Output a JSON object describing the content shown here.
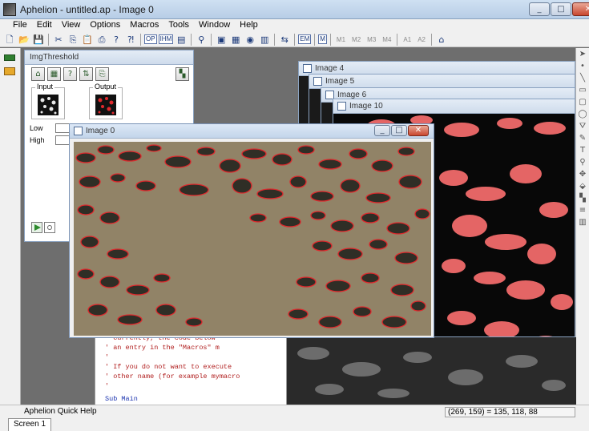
{
  "window": {
    "title": "Aphelion - untitled.ap - Image 0",
    "controls": [
      "_",
      "□",
      "✕"
    ]
  },
  "menu": [
    "File",
    "Edit",
    "View",
    "Options",
    "Macros",
    "Tools",
    "Window",
    "Help"
  ],
  "toolbar": {
    "labels": [
      "M1",
      "M2",
      "M3",
      "M4",
      "A1",
      "A2"
    ],
    "text_buttons": [
      "OP",
      "IHM",
      "EM",
      "M"
    ]
  },
  "threshold_panel": {
    "title": "ImgThreshold",
    "input_label": "Input",
    "output_label": "Output",
    "low_label": "Low",
    "high_label": "High"
  },
  "image_windows": [
    {
      "title": "Image 4"
    },
    {
      "title": "Image 5"
    },
    {
      "title": "Image 6"
    },
    {
      "title": "Image 10"
    }
  ],
  "main_image": {
    "title": "Image 0"
  },
  "code_editor": {
    "lines": [
      {
        "text": "' Currently, the code below",
        "kw": false
      },
      {
        "text": "' an entry in the \"Macros\" m",
        "kw": false
      },
      {
        "text": "'",
        "kw": false
      },
      {
        "text": "' If you do not want to execute",
        "kw": false
      },
      {
        "text": "' other name (for example mymacro",
        "kw": false
      },
      {
        "text": "'",
        "kw": false
      },
      {
        "text": "",
        "kw": false
      },
      {
        "text": "Sub Main",
        "kw": true
      }
    ]
  },
  "status": {
    "help_text": "Aphelion Quick Help",
    "coordinates": "(269,  159) = 135, 118, 88",
    "tab_label": "Screen 1"
  },
  "colors": {
    "accent_red": "#e0282c",
    "image_bg": "#8c7d62",
    "blob_fill": "#2f2e26"
  }
}
